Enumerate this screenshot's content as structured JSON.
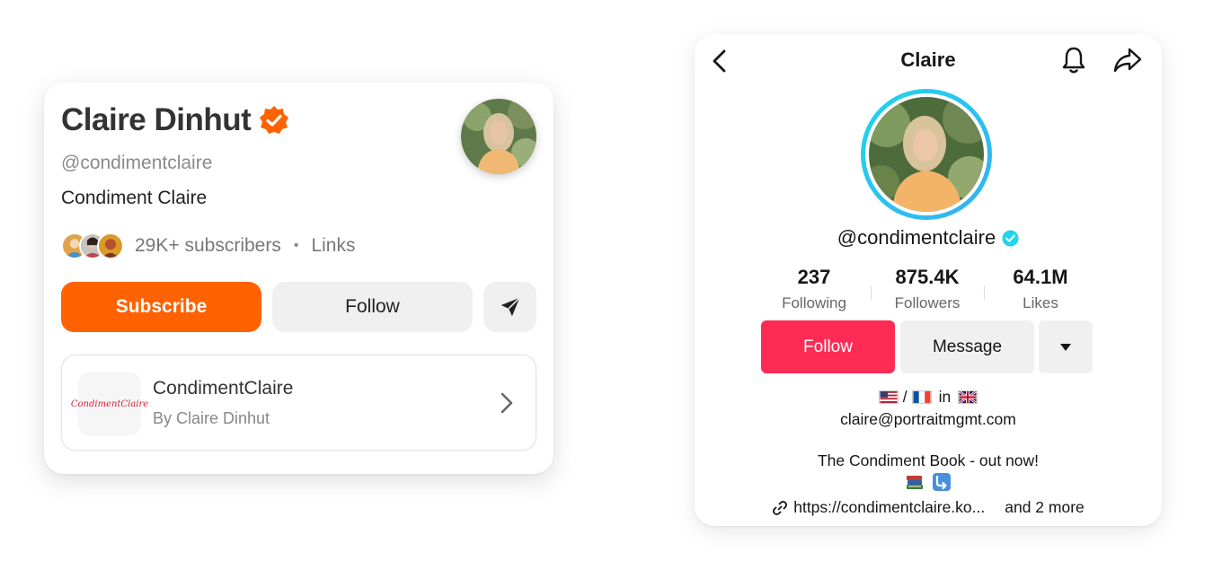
{
  "substack_card": {
    "name": "Claire Dinhut",
    "handle": "@condimentclaire",
    "publication_title": "Condiment Claire",
    "subscribers": "29K+ subscribers",
    "separator": "•",
    "links_label": "Links",
    "subscribe_label": "Subscribe",
    "follow_label": "Follow",
    "publication": {
      "logo_text": "CondimentClaire",
      "name": "CondimentClaire",
      "byline": "By Claire Dinhut"
    },
    "accent_color": "#ff6200",
    "icons": [
      "verified-badge-icon",
      "send-icon",
      "chevron-right-icon"
    ]
  },
  "tiktok_card": {
    "title": "Claire",
    "handle": "@condimentclaire",
    "stats": [
      {
        "value": "237",
        "label": "Following"
      },
      {
        "value": "875.4K",
        "label": "Followers"
      },
      {
        "value": "64.1M",
        "label": "Likes"
      }
    ],
    "follow_label": "Follow",
    "message_label": "Message",
    "bio": {
      "flags_sep": "/",
      "flags_in": "in",
      "email": "claire@portraitmgmt.com",
      "book_line": "The Condiment Book - out now!",
      "link": "https://condimentclaire.ko...",
      "and_more": "and 2 more"
    },
    "accent_color": "#fe2c55",
    "ring_color": "#20d5ec",
    "icons": [
      "back-arrow-icon",
      "bell-icon",
      "share-icon",
      "caret-down-icon",
      "link-icon"
    ]
  }
}
